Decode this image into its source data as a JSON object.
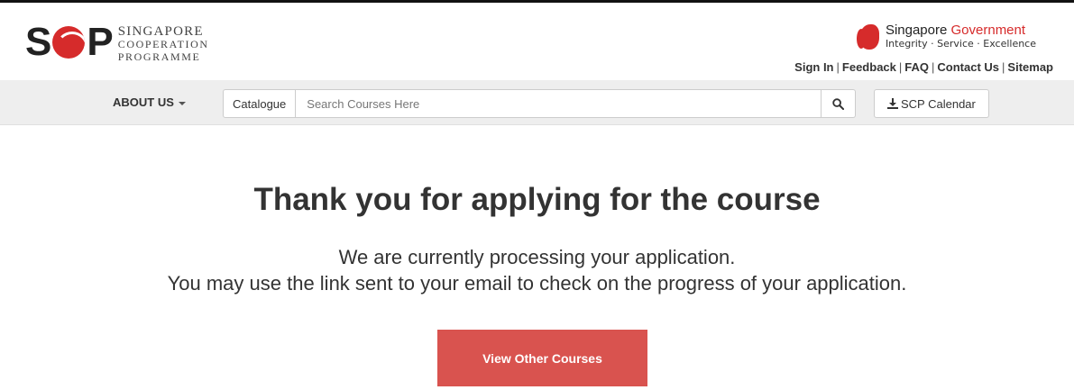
{
  "header": {
    "logo": {
      "mark": "SCP",
      "line1": "SINGAPORE",
      "line2": "COOPERATION",
      "line3": "PROGRAMME"
    },
    "govt": {
      "name_prefix": "Singapore",
      "name_suffix": "Government",
      "tagline": "Integrity · Service · Excellence"
    },
    "links": [
      {
        "label": "Sign In"
      },
      {
        "label": "Feedback"
      },
      {
        "label": "FAQ"
      },
      {
        "label": "Contact Us"
      },
      {
        "label": "Sitemap"
      }
    ]
  },
  "nav": {
    "about_label": "ABOUT US",
    "catalogue_label": "Catalogue",
    "search_placeholder": "Search Courses Here",
    "search_icon": "search-icon",
    "calendar_label": "SCP Calendar",
    "calendar_icon": "download-icon"
  },
  "main": {
    "title": "Thank you for applying for the course",
    "message_line1": "We are currently processing your application.",
    "message_line2": "You may use the link sent to your email to check on the progress of your application.",
    "cta_label": "View Other Courses"
  },
  "colors": {
    "brand_red": "#d62b2b",
    "cta_red": "#d9534f",
    "nav_bg": "#eeeeee"
  }
}
